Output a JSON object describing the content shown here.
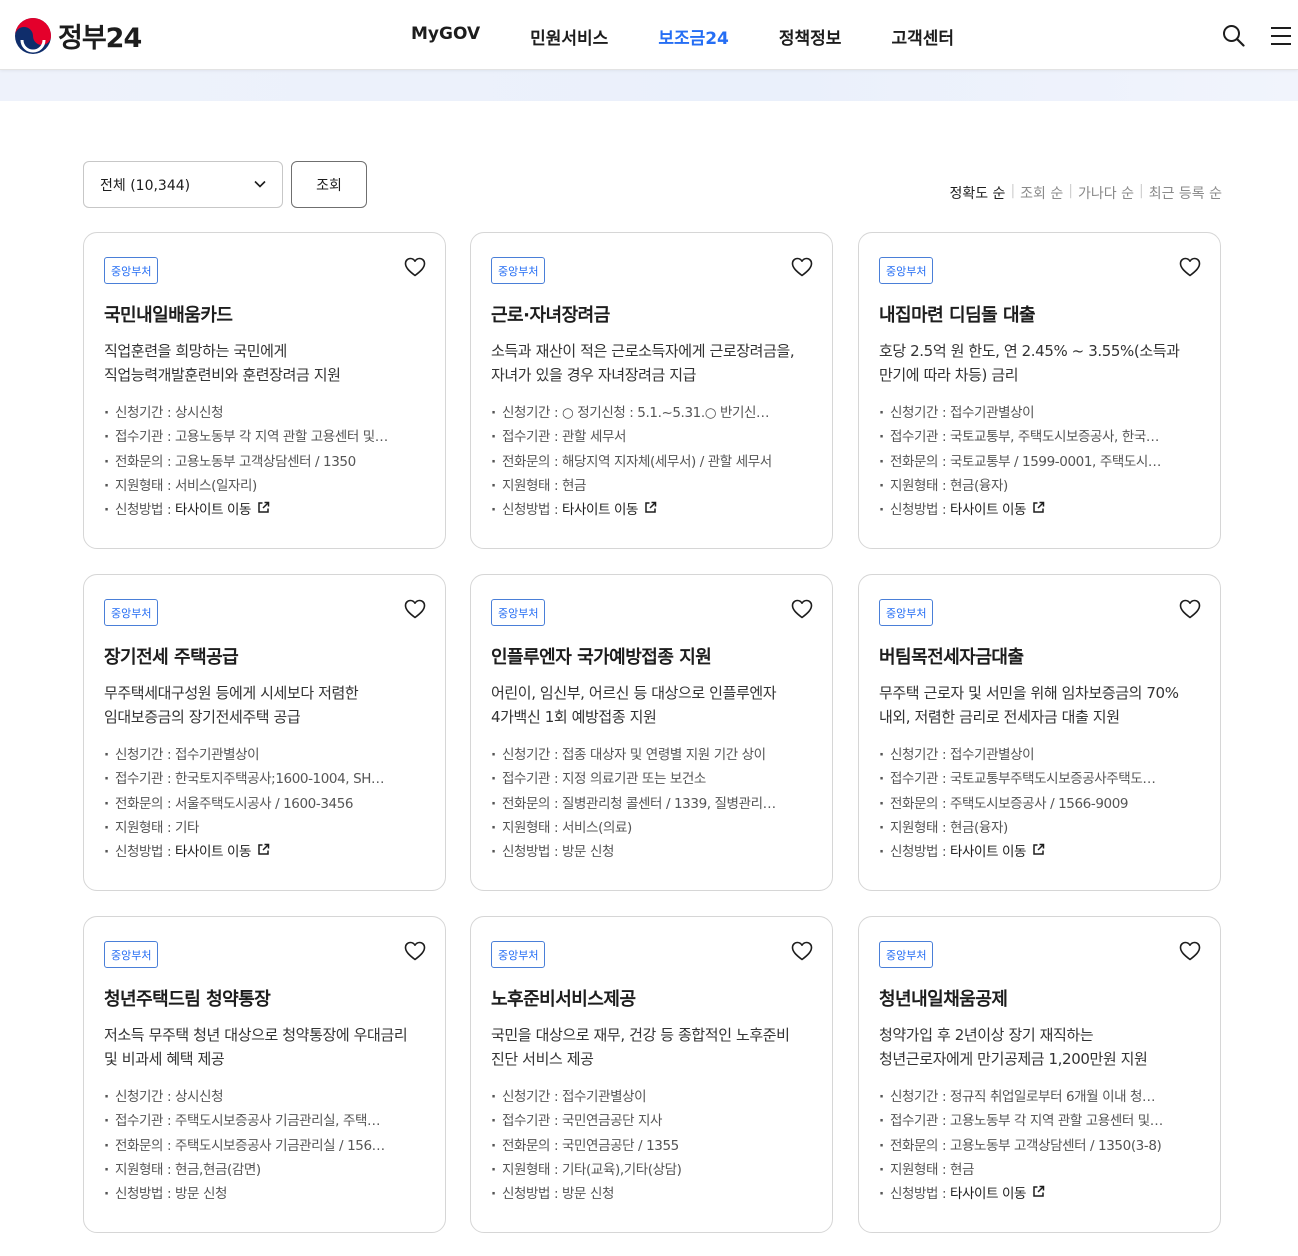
{
  "header": {
    "logo_text": "정부24",
    "nav": [
      "MyGOV",
      "민원서비스",
      "보조금24",
      "정책정보",
      "고객센터"
    ],
    "active_nav": "보조금24",
    "icons": [
      "search-icon",
      "menu-icon"
    ]
  },
  "toolbar": {
    "select_value": "전체 (10,344)",
    "search_label": "조회",
    "sort": [
      "정확도 순",
      "조회 순",
      "가나다 순",
      "최근 등록 순"
    ],
    "sort_active": "정확도 순"
  },
  "labels": {
    "period": "신청기간 : ",
    "agency": "접수기관 : ",
    "phone": "전화문의 : ",
    "type": "지원형태 : ",
    "method": "신청방법 : "
  },
  "colors": {
    "accent": "#256ef4"
  },
  "cards": [
    {
      "badge": "중앙부처",
      "title": "국민내일배움카드",
      "desc": [
        "직업훈련을 희망하는 국민에게",
        "직업능력개발훈련비와 훈련장려금 지원"
      ],
      "period": "상시신청",
      "agency": "고용노동부 각 지역 관할 고용센터 및…",
      "phone": "고용노동부 고객상담센터 / 1350",
      "type": "서비스(일자리)",
      "method": "타사이트 이동",
      "method_link": true
    },
    {
      "badge": "중앙부처",
      "title": "근로·자녀장려금",
      "desc": [
        "소득과 재산이 적은 근로소득자에게 근로장려금을,",
        "자녀가 있을 경우 자녀장려금 지급"
      ],
      "period": "○ 정기신청 : 5.1.~5.31.○ 반기신…",
      "agency": "관할 세무서",
      "phone": "해당지역 지자체(세무서) / 관할 세무서",
      "type": "현금",
      "method": "타사이트 이동",
      "method_link": true
    },
    {
      "badge": "중앙부처",
      "title": "내집마련 디딤돌 대출",
      "desc": [
        "호당 2.5억 원 한도, 연 2.45% ~ 3.55%(소득과",
        "만기에 따라 차등) 금리"
      ],
      "period": "접수기관별상이",
      "agency": "국토교통부, 주택도시보증공사, 한국…",
      "phone": "국토교통부 / 1599-0001, 주택도시…",
      "type": "현금(융자)",
      "method": "타사이트 이동",
      "method_link": true
    },
    {
      "badge": "중앙부처",
      "title": "장기전세 주택공급",
      "desc": [
        "무주택세대구성원 등에게 시세보다 저렴한",
        "임대보증금의 장기전세주택 공급"
      ],
      "period": "접수기관별상이",
      "agency": "한국토지주택공사;1600-1004, SH…",
      "phone": "서울주택도시공사 / 1600-3456",
      "type": "기타",
      "method": "타사이트 이동",
      "method_link": true
    },
    {
      "badge": "중앙부처",
      "title": "인플루엔자 국가예방접종 지원",
      "desc": [
        "어린이, 임신부, 어르신 등 대상으로 인플루엔자",
        "4가백신 1회 예방접종 지원"
      ],
      "period": "접종 대상자 및 연령별 지원 기간 상이",
      "agency": "지정 의료기관 또는 보건소",
      "phone": "질병관리청 콜센터 / 1339, 질병관리…",
      "type": "서비스(의료)",
      "method": "방문 신청",
      "method_link": false
    },
    {
      "badge": "중앙부처",
      "title": "버팀목전세자금대출",
      "desc": [
        "무주택 근로자 및 서민을 위해 임차보증금의 70%",
        "내외, 저렴한 금리로 전세자금 대출 지원"
      ],
      "period": "접수기관별상이",
      "agency": "국토교통부주택도시보증공사주택도…",
      "phone": "주택도시보증공사 / 1566-9009",
      "type": "현금(융자)",
      "method": "타사이트 이동",
      "method_link": true
    },
    {
      "badge": "중앙부처",
      "title": "청년주택드림 청약통장",
      "desc": [
        "저소득 무주택 청년 대상으로 청약통장에 우대금리",
        "및 비과세 혜택 제공"
      ],
      "period": "상시신청",
      "agency": "주택도시보증공사 기금관리실, 주택…",
      "phone": "주택도시보증공사 기금관리실 / 156…",
      "type": "현금,현금(감면)",
      "method": "방문 신청",
      "method_link": false
    },
    {
      "badge": "중앙부처",
      "title": "노후준비서비스제공",
      "desc": [
        "국민을 대상으로 재무, 건강 등 종합적인 노후준비",
        "진단 서비스 제공"
      ],
      "period": "접수기관별상이",
      "agency": "국민연금공단 지사",
      "phone": "국민연금공단 / 1355",
      "type": "기타(교육),기타(상담)",
      "method": "방문 신청",
      "method_link": false
    },
    {
      "badge": "중앙부처",
      "title": "청년내일채움공제",
      "desc": [
        "청약가입 후 2년이상 장기 재직하는",
        "청년근로자에게 만기공제금 1,200만원 지원"
      ],
      "period": "정규직 취업일로부터 6개월 이내 청…",
      "agency": "고용노동부 각 지역 관할 고용센터 및…",
      "phone": "고용노동부 고객상담센터 / 1350(3-8)",
      "type": "현금",
      "method": "타사이트 이동",
      "method_link": true
    }
  ]
}
